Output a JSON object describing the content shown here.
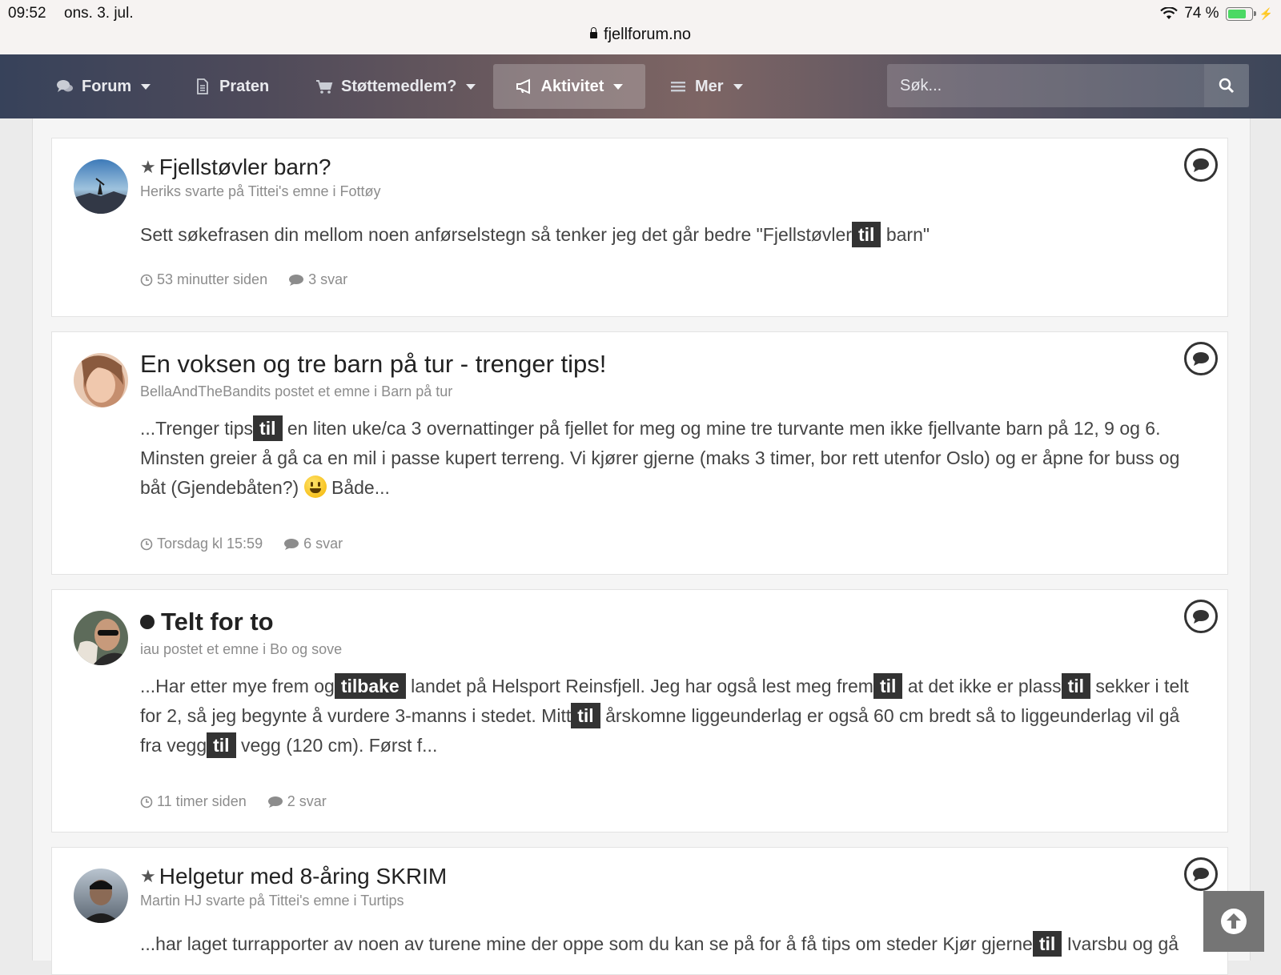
{
  "status": {
    "time": "09:52",
    "date": "ons. 3. jul.",
    "url": "fjellforum.no",
    "battery": "74 %"
  },
  "nav": {
    "items": [
      {
        "label": "Forum",
        "icon": "comments-icon"
      },
      {
        "label": "Praten",
        "icon": "document-icon"
      },
      {
        "label": "Støttemedlem?",
        "icon": "cart-icon"
      },
      {
        "label": "Aktivitet",
        "icon": "megaphone-icon"
      },
      {
        "label": "Mer",
        "icon": "menu-icon"
      }
    ],
    "search_placeholder": "Søk..."
  },
  "posts": [
    {
      "title": "Fjellstøvler barn?",
      "meta": "Heriks svarte på Tittei's emne i Fottøy",
      "snippet": [
        "Sett søkefrasen din mellom noen anførselstegn så tenker jeg det går bedre \"Fjellstøvler",
        "til",
        "barn\""
      ],
      "time": "53 minutter siden",
      "replies": "3 svar"
    },
    {
      "title": "En voksen og tre barn på tur - trenger tips!",
      "meta": "BellaAndTheBandits postet et emne i Barn på tur",
      "snippet": [
        "...Trenger tips",
        "til",
        "en liten uke/ca 3 overnattinger på fjellet for meg og mine tre turvante men ikke fjellvante barn på 12, 9 og 6. Minsten greier å gå ca en mil i passe kupert terreng. Vi kjører gjerne (maks 3 timer, bor rett utenfor Oslo) og er åpne for buss og båt (Gjendebåten?)",
        "Både..."
      ],
      "time": "Torsdag kl 15:59",
      "replies": "6 svar"
    },
    {
      "title": "Telt for to",
      "meta": "iau postet et emne i Bo og sove",
      "snippet": [
        "...Har etter mye frem og",
        "tilbake",
        "landet på Helsport Reinsfjell. Jeg har også lest meg frem",
        "til",
        "at det ikke er plass",
        "til",
        "sekker i telt for 2, så jeg begynte å vurdere 3-manns i stedet. Mitt",
        "til",
        "årskomne liggeunderlag er også 60 cm bredt så to liggeunderlag vil gå fra vegg",
        "til",
        "vegg (120 cm). Først f..."
      ],
      "time": "11 timer siden",
      "replies": "2 svar"
    },
    {
      "title": "Helgetur med 8-åring SKRIM",
      "meta": "Martin HJ svarte på Tittei's emne i Turtips",
      "snippet": [
        "...har laget turrapporter av noen av turene mine der oppe som du kan se på for å få tips om steder Kjør gjerne",
        "til",
        "Ivarsbu og gå"
      ]
    }
  ],
  "colors": {
    "highlight_bg": "#333333",
    "battery_green": "#4cd964"
  }
}
